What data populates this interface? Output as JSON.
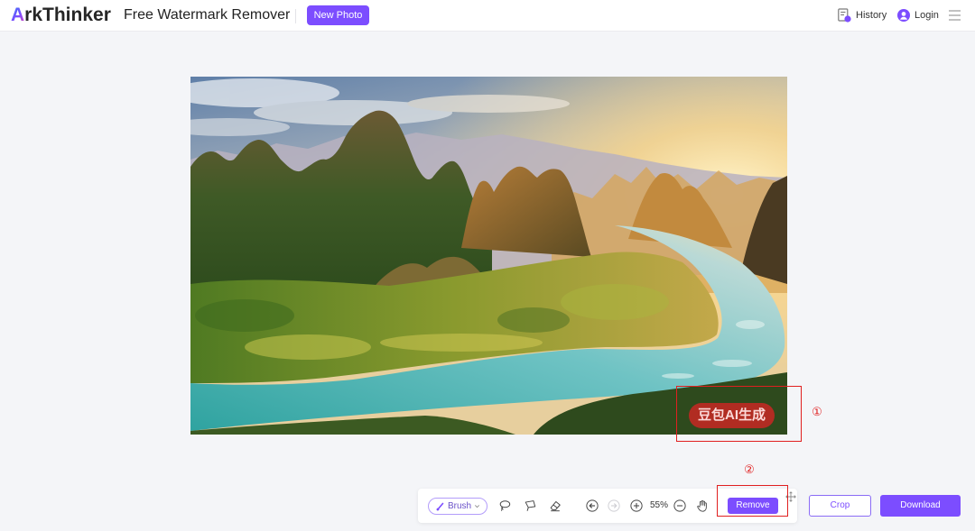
{
  "header": {
    "brand": {
      "initial": "A",
      "rest": "rkThinker"
    },
    "title": "Free Watermark Remover",
    "new_photo_label": "New Photo",
    "history_label": "History",
    "login_label": "Login"
  },
  "canvas": {
    "watermark_text": "豆包AI生成"
  },
  "annotations": {
    "marker_1": "①",
    "marker_2": "②"
  },
  "toolbar": {
    "brush_label": "Brush",
    "zoom_level": "55%",
    "remove_label": "Remove"
  },
  "actions": {
    "crop_label": "Crop",
    "download_label": "Download"
  },
  "icons": {
    "history": "history-icon",
    "login": "user-icon",
    "menu": "menu-icon",
    "brush": "brush-icon",
    "brush_dropdown": "chevron-down-icon",
    "lasso": "lasso-icon",
    "polygon_lasso": "polygon-lasso-icon",
    "eraser": "eraser-icon",
    "undo": "undo-icon",
    "redo": "redo-icon",
    "zoom_in": "zoom-in-icon",
    "zoom_out": "zoom-out-icon",
    "pan": "hand-icon",
    "move": "move-icon"
  },
  "colors": {
    "accent": "#7c4dff",
    "annotation": "#e02020",
    "background": "#f4f5f8",
    "header_background": "#ffffff"
  }
}
